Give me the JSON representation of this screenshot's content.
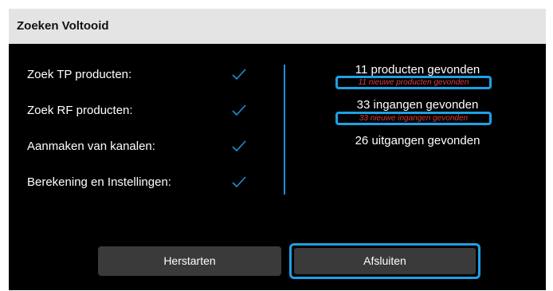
{
  "dialog": {
    "title": "Zoeken Voltooid"
  },
  "steps": [
    {
      "label": "Zoek TP producten:",
      "status": "check-icon"
    },
    {
      "label": "Zoek RF producten:",
      "status": "check-icon"
    },
    {
      "label": "Aanmaken van kanalen:",
      "status": "check-icon"
    },
    {
      "label": "Berekening en Instellingen:",
      "status": "check-icon"
    }
  ],
  "results": {
    "products_found": "11 producten gevonden",
    "new_products": "11 nieuwe producten gevonden",
    "inputs_found": "33 ingangen gevonden",
    "new_inputs": "33 nieuwe ingangen gevonden",
    "outputs_found": "26 uitgangen gevonden"
  },
  "buttons": {
    "restart": "Herstarten",
    "close": "Afsluiten"
  },
  "colors": {
    "dialog_bg": "#000000",
    "title_bar_bg": "#e4e4e4",
    "accent": "#1ea0e6",
    "check": "#1f8fd0",
    "highlight_text": "#e03b3b",
    "button_bg": "#3a3a3a"
  }
}
